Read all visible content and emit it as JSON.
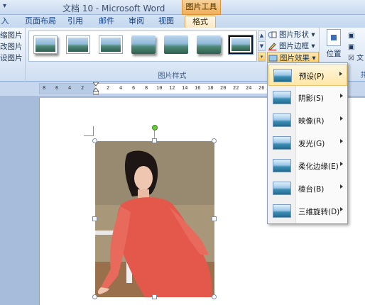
{
  "window": {
    "title": "文档 10 - Microsoft Word",
    "quick_access": "▾",
    "context_tool": "图片工具"
  },
  "tabs": [
    {
      "label": "入",
      "active": false
    },
    {
      "label": "页面布局",
      "active": false
    },
    {
      "label": "引用",
      "active": false
    },
    {
      "label": "邮件",
      "active": false
    },
    {
      "label": "审阅",
      "active": false
    },
    {
      "label": "视图",
      "active": false
    },
    {
      "label": "格式",
      "active": true
    }
  ],
  "ribbon": {
    "left_items": [
      "缩图片",
      "改图片",
      "设图片"
    ],
    "gallery_group_label": "图片样式",
    "buttons": {
      "shape": "图片形状",
      "border": "图片边框",
      "effects": "图片效果"
    },
    "position_label": "位置",
    "right_label": "文",
    "right_group_label": "排"
  },
  "ruler": {
    "ticks": [
      "8",
      "6",
      "4",
      "2",
      "",
      "2",
      "4",
      "6",
      "8",
      "10",
      "12",
      "14",
      "16",
      "18",
      "20",
      "22",
      "24",
      "26"
    ]
  },
  "menu": {
    "items": [
      {
        "label": "预设(P)",
        "key": "P"
      },
      {
        "label": "阴影(S)",
        "key": "S"
      },
      {
        "label": "映像(R)",
        "key": "R"
      },
      {
        "label": "发光(G)",
        "key": "G"
      },
      {
        "label": "柔化边缘(E)",
        "key": "E"
      },
      {
        "label": "棱台(B)",
        "key": "B"
      },
      {
        "label": "三维旋转(D)",
        "key": "D"
      }
    ]
  },
  "colors": {
    "accent": "#f0b05a",
    "ribbon": "#dfe9f6",
    "page": "#ffffff"
  }
}
